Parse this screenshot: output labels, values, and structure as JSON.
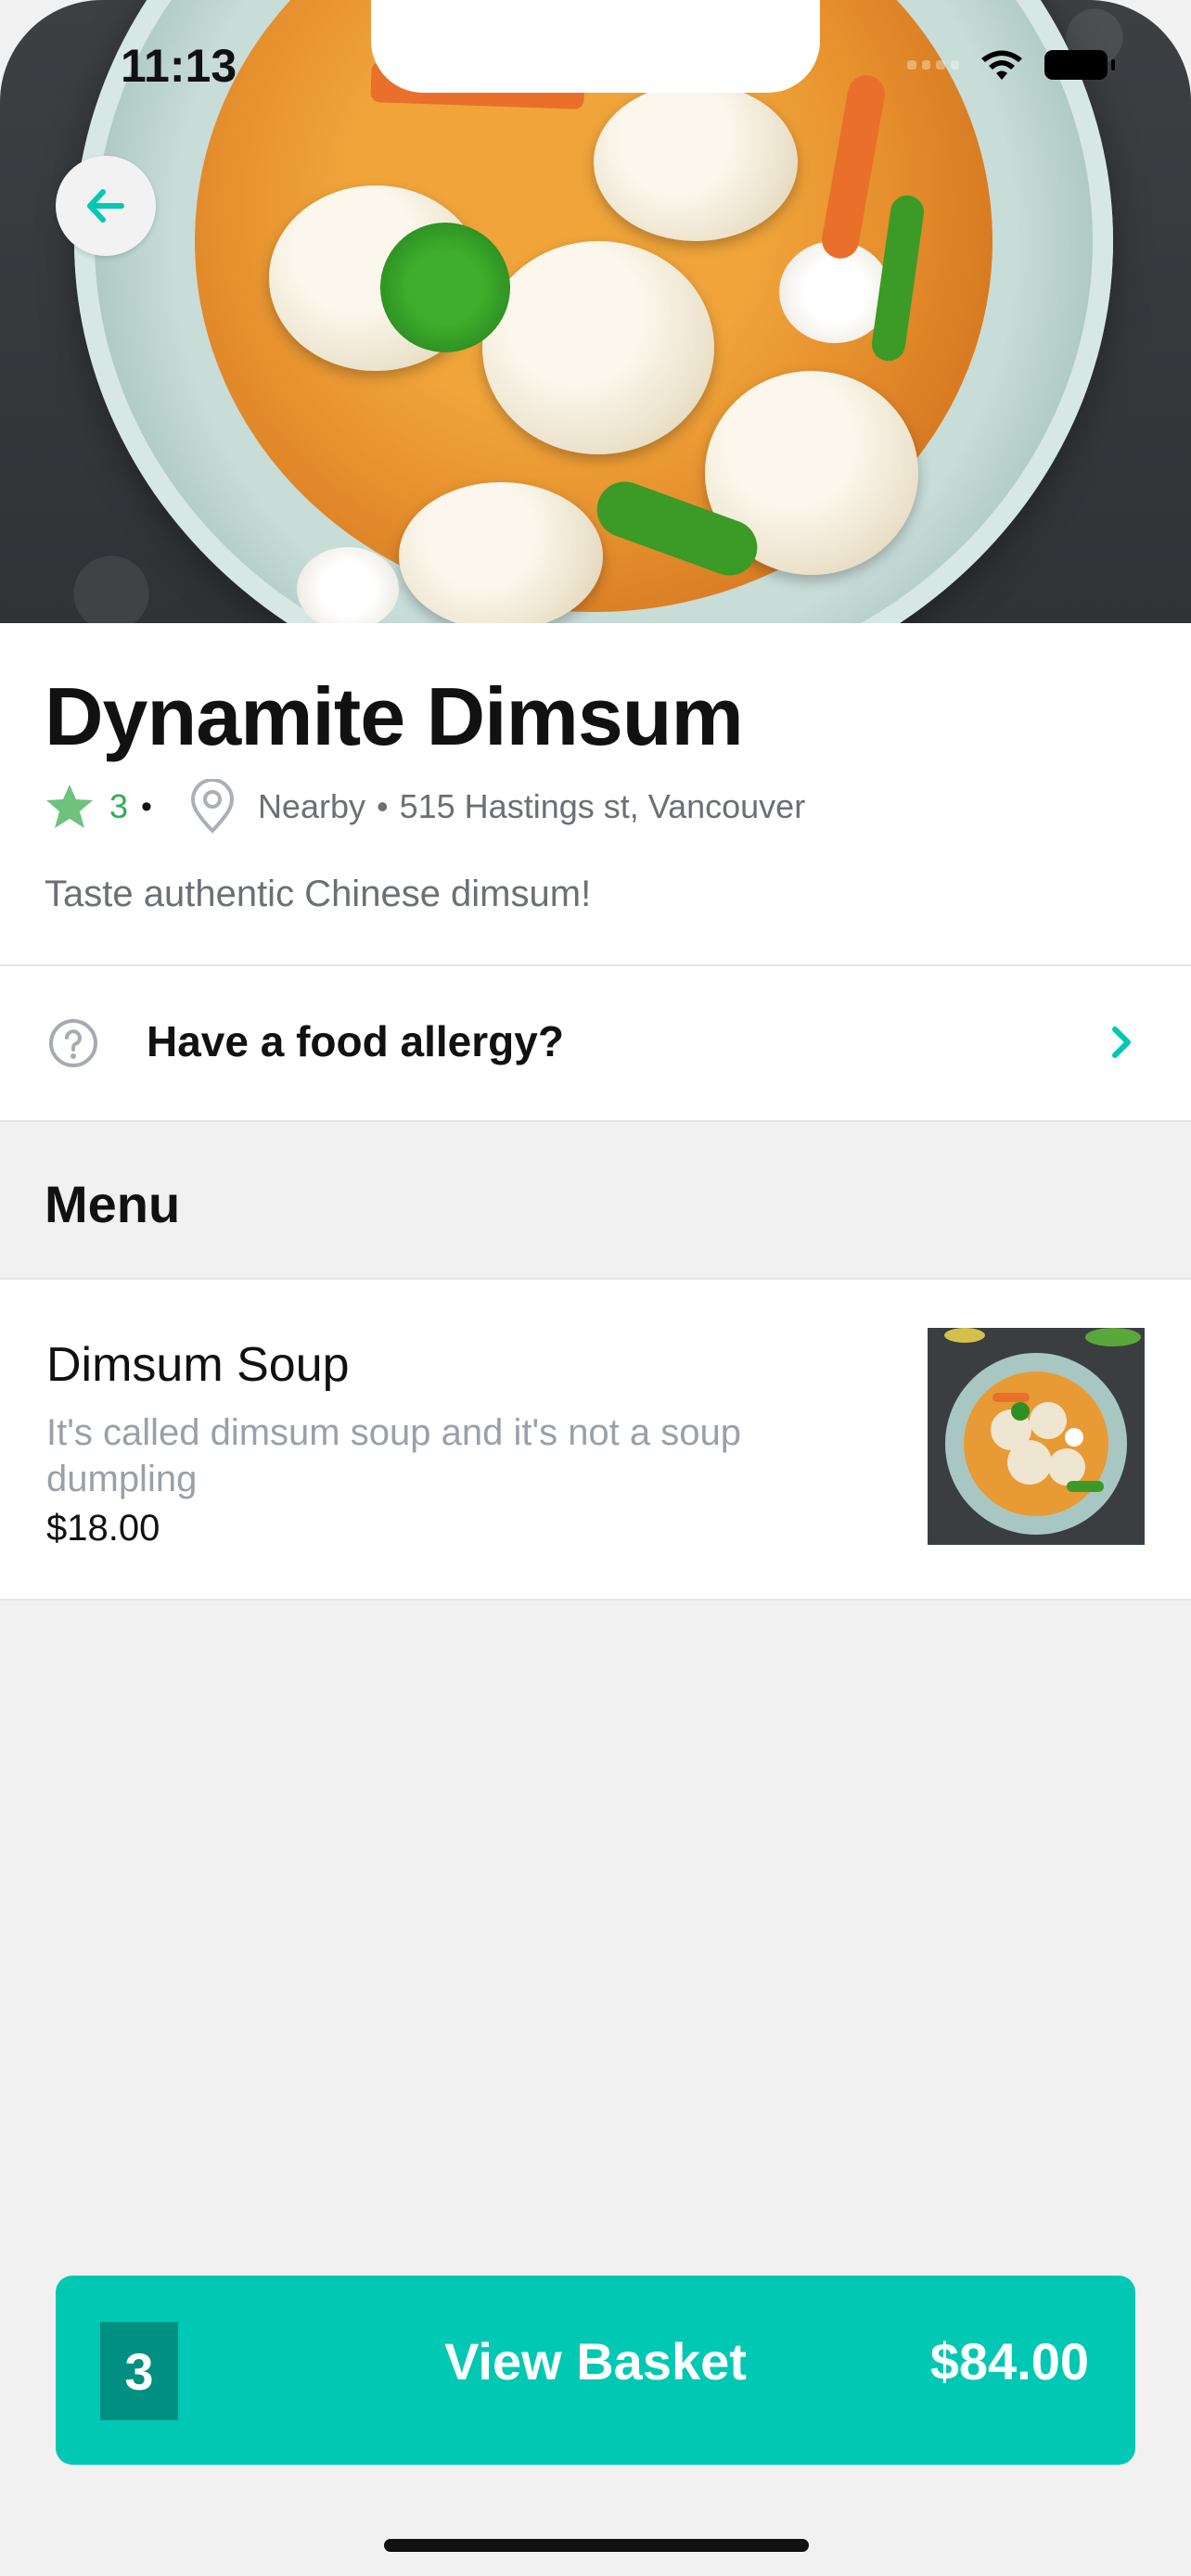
{
  "status_bar": {
    "time": "11:13"
  },
  "restaurant": {
    "name": "Dynamite Dimsum",
    "rating": "3",
    "distance": "Nearby",
    "address": "515 Hastings st, Vancouver",
    "description": "Taste authentic Chinese dimsum!"
  },
  "allergy": {
    "label": "Have a food allergy?"
  },
  "menu": {
    "heading": "Menu",
    "items": [
      {
        "name": "Dimsum Soup",
        "description": "It's called dimsum soup and it's not a soup dumpling",
        "price": "$18.00"
      }
    ]
  },
  "basket": {
    "count": "3",
    "label": "View Basket",
    "total": "$84.00"
  },
  "colors": {
    "accent": "#00c8b3",
    "accent_dark": "#008f80",
    "rating_green": "#2fae58"
  },
  "icons": [
    "back-arrow-icon",
    "star-icon",
    "location-pin-icon",
    "question-circle-icon",
    "chevron-right-icon",
    "wifi-icon",
    "battery-icon"
  ]
}
